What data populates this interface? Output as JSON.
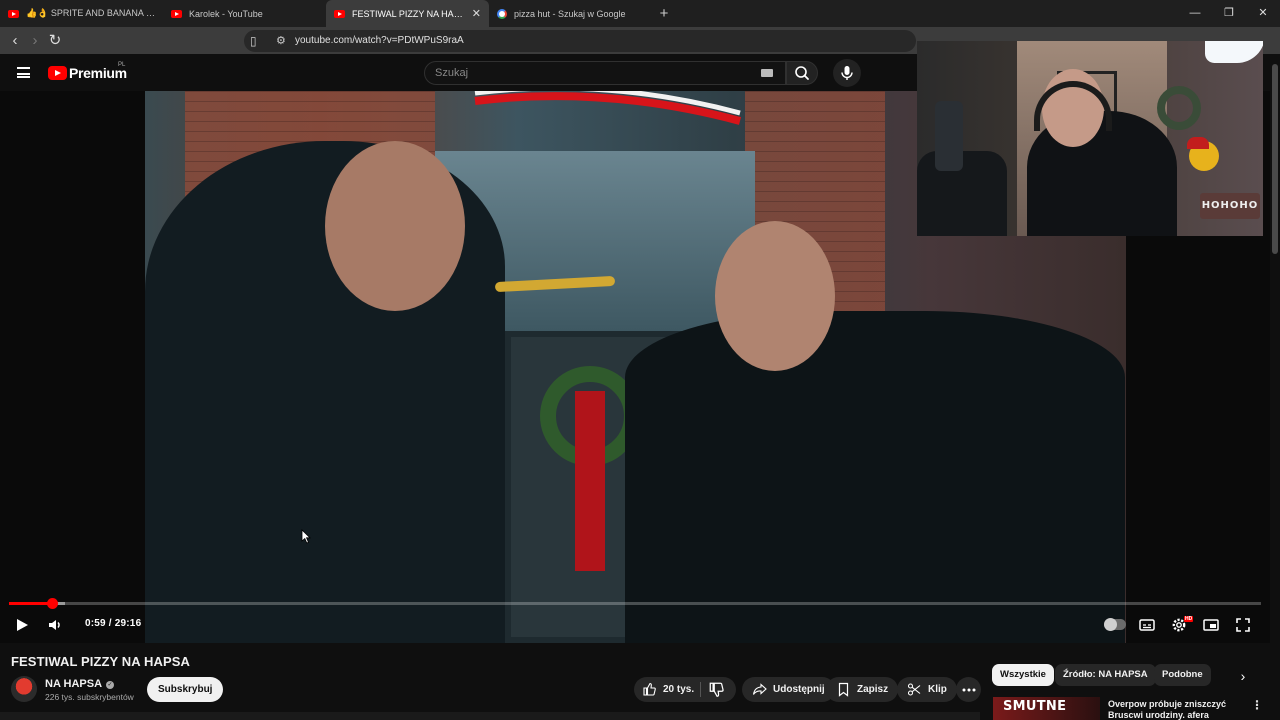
{
  "browser": {
    "tabs": [
      {
        "label": "👍👌 SPRITE AND BANANA CHALL",
        "active": false,
        "favicon": "youtube-icon"
      },
      {
        "label": "Karolek - YouTube",
        "active": false,
        "favicon": "youtube-icon"
      },
      {
        "label": "FESTIWAL PIZZY NA HAPSA - You",
        "active": true,
        "favicon": "youtube-icon"
      },
      {
        "label": "pizza hut - Szukaj w Google",
        "active": false,
        "favicon": "google-icon"
      }
    ],
    "url": "youtube.com/watch?v=PDtWPuS9raA"
  },
  "youtube": {
    "logo_text": "Premium",
    "logo_country": "PL",
    "search_placeholder": "Szukaj"
  },
  "player": {
    "current_time": "0:59",
    "duration": "29:16",
    "time_display": "0:59 / 29:16",
    "progress_fraction": 0.034,
    "buffered_fraction": 0.045,
    "hd_badge": "HD"
  },
  "webcam": {
    "sign_text": "HOHOHO"
  },
  "video": {
    "title": "FESTIWAL PIZZY NA HAPSA",
    "channel": "NA HAPSA",
    "subscribers": "226 tys. subskrybentów",
    "subscribe_label": "Subskrybuj",
    "likes": "20 tys.",
    "share_label": "Udostępnij",
    "save_label": "Zapisz",
    "clip_label": "Klip"
  },
  "chips": [
    {
      "label": "Wszystkie",
      "active": true
    },
    {
      "label": "Źródło: NA HAPSA",
      "active": false
    },
    {
      "label": "Podobne",
      "active": false
    }
  ],
  "recommendation": {
    "thumb_text": "SMUTNE",
    "title": "Overpow próbuje zniszczyć Bruscwi urodziny. afera"
  },
  "colors": {
    "accent": "#ff0000",
    "background": "#0f0f0f",
    "chip_bg": "#272727"
  }
}
